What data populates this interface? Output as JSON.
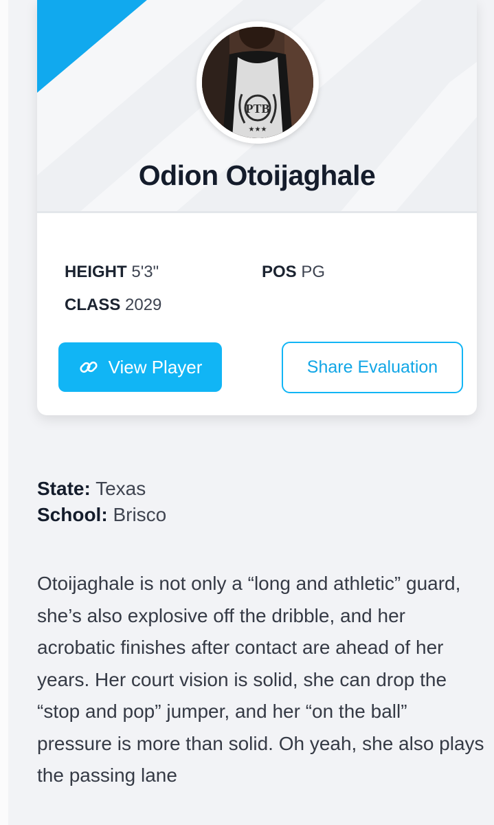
{
  "player": {
    "name": "Odion Otoijaghale",
    "avatar_alt": "player-photo"
  },
  "stats": {
    "height_label": "HEIGHT",
    "height_value": "5'3\"",
    "pos_label": "POS",
    "pos_value": "PG",
    "class_label": "CLASS",
    "class_value": "2029"
  },
  "actions": {
    "view_player": "View Player",
    "share_evaluation": "Share Evaluation"
  },
  "meta": {
    "state_label": "State:",
    "state_value": "Texas",
    "school_label": "School:",
    "school_value": "Brisco"
  },
  "evaluation": {
    "text": "Otoijaghale is not only a “long and athletic” guard, she’s also explosive off the dribble, and her acrobatic finishes after contact are ahead of her years. Her court vision is solid, she can drop the “stop and pop” jumper, and her “on the ball” pressure is more than solid. Oh yeah, she also plays the passing lane"
  },
  "colors": {
    "accent": "#11b5f5",
    "name_text": "#141c2b",
    "background": "#f2f3f6"
  },
  "icons": {
    "view_player": "link-icon"
  }
}
